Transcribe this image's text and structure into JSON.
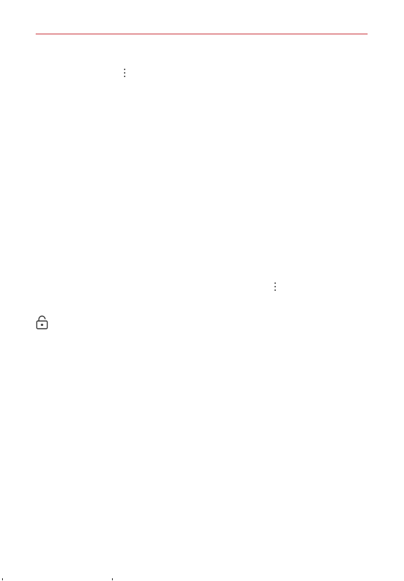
{
  "header": {
    "rule_color": "#c8323a"
  },
  "icons": {
    "menu_icon_top": "more-vertical-icon",
    "menu_icon_middle": "more-vertical-icon",
    "lock_icon": "lock-icon"
  },
  "colors": {
    "background": "#ffffff",
    "icon": "#333333",
    "accent": "#c8323a"
  }
}
